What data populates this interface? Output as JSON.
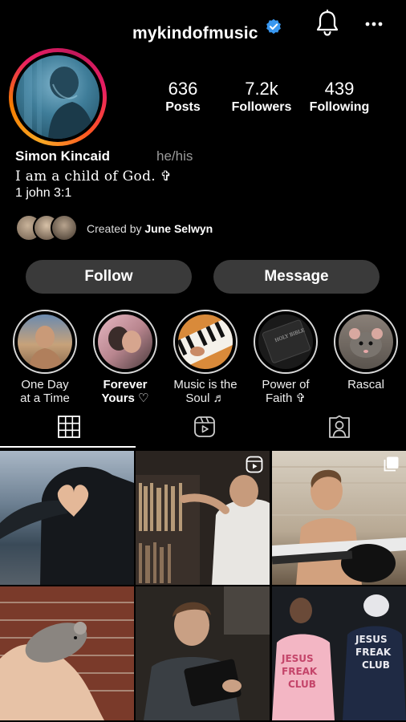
{
  "header": {
    "username": "mykindofmusic"
  },
  "stats": {
    "posts": {
      "value": "636",
      "label": "Posts"
    },
    "followers": {
      "value": "7.2k",
      "label": "Followers"
    },
    "following": {
      "value": "439",
      "label": "Following"
    }
  },
  "profile": {
    "name": "Simon Kincaid",
    "pronouns": "he/his",
    "bio_line1": "I am a child of God. ✞",
    "bio_line2": "1 john 3:1",
    "created_prefix": "Created by ",
    "created_by": "June Selwyn"
  },
  "buttons": {
    "follow": "Follow",
    "message": "Message"
  },
  "highlights": [
    {
      "label": "One Day\nat a Time",
      "bold": false
    },
    {
      "label": "Forever\nYours ♡",
      "bold": true
    },
    {
      "label": "Music is the\nSoul ♬",
      "bold": false
    },
    {
      "label": "Power of\nFaith ✞",
      "bold": false
    },
    {
      "label": "Rascal",
      "bold": false
    }
  ],
  "tabs": {
    "grid_icon": "grid-icon",
    "reels_icon": "reels-icon",
    "tagged_icon": "tagged-icon",
    "active": "grid"
  },
  "colors": {
    "background": "#000000",
    "button_bg": "#3a3a3a",
    "verified_blue": "#3897f0",
    "muted_text": "#9a9a9a"
  }
}
